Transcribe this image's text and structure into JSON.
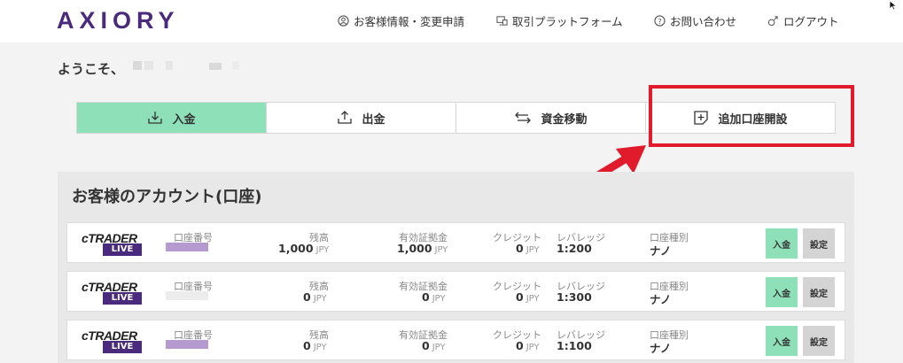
{
  "header": {
    "logo": "AXIORY",
    "nav": [
      {
        "label": "お客様情報・変更申請",
        "icon": "person-circle-icon"
      },
      {
        "label": "取引プラットフォーム",
        "icon": "monitor-icon"
      },
      {
        "label": "お問い合わせ",
        "icon": "question-circle-icon"
      },
      {
        "label": "ログアウト",
        "icon": "logout-icon"
      }
    ]
  },
  "welcome": "ようこそ、",
  "actions": [
    {
      "label": "入金",
      "icon": "deposit-icon"
    },
    {
      "label": "出金",
      "icon": "withdraw-icon"
    },
    {
      "label": "資金移動",
      "icon": "transfer-icon"
    },
    {
      "label": "追加口座開設",
      "icon": "add-account-icon"
    }
  ],
  "accounts": {
    "title": "お客様のアカウント(口座)",
    "columns": {
      "account_no": "口座番号",
      "balance": "残高",
      "margin": "有効証拠金",
      "credit": "クレジット",
      "leverage": "レバレッジ",
      "type": "口座種別"
    },
    "currency": "JPY",
    "platform": "cTRADER",
    "badge": "LIVE",
    "deposit_label": "入金",
    "settings_label": "設定",
    "rows": [
      {
        "balance": "1,000",
        "margin": "1,000",
        "credit": "0",
        "leverage": "1:200",
        "type": "ナノ"
      },
      {
        "balance": "0",
        "margin": "0",
        "credit": "0",
        "leverage": "1:300",
        "type": "ナノ"
      },
      {
        "balance": "0",
        "margin": "0",
        "credit": "0",
        "leverage": "1:100",
        "type": "ナノ"
      }
    ]
  },
  "colors": {
    "brand": "#4a2a7c",
    "accent_green": "#8ee0b8",
    "highlight_red": "#e11b2b"
  }
}
